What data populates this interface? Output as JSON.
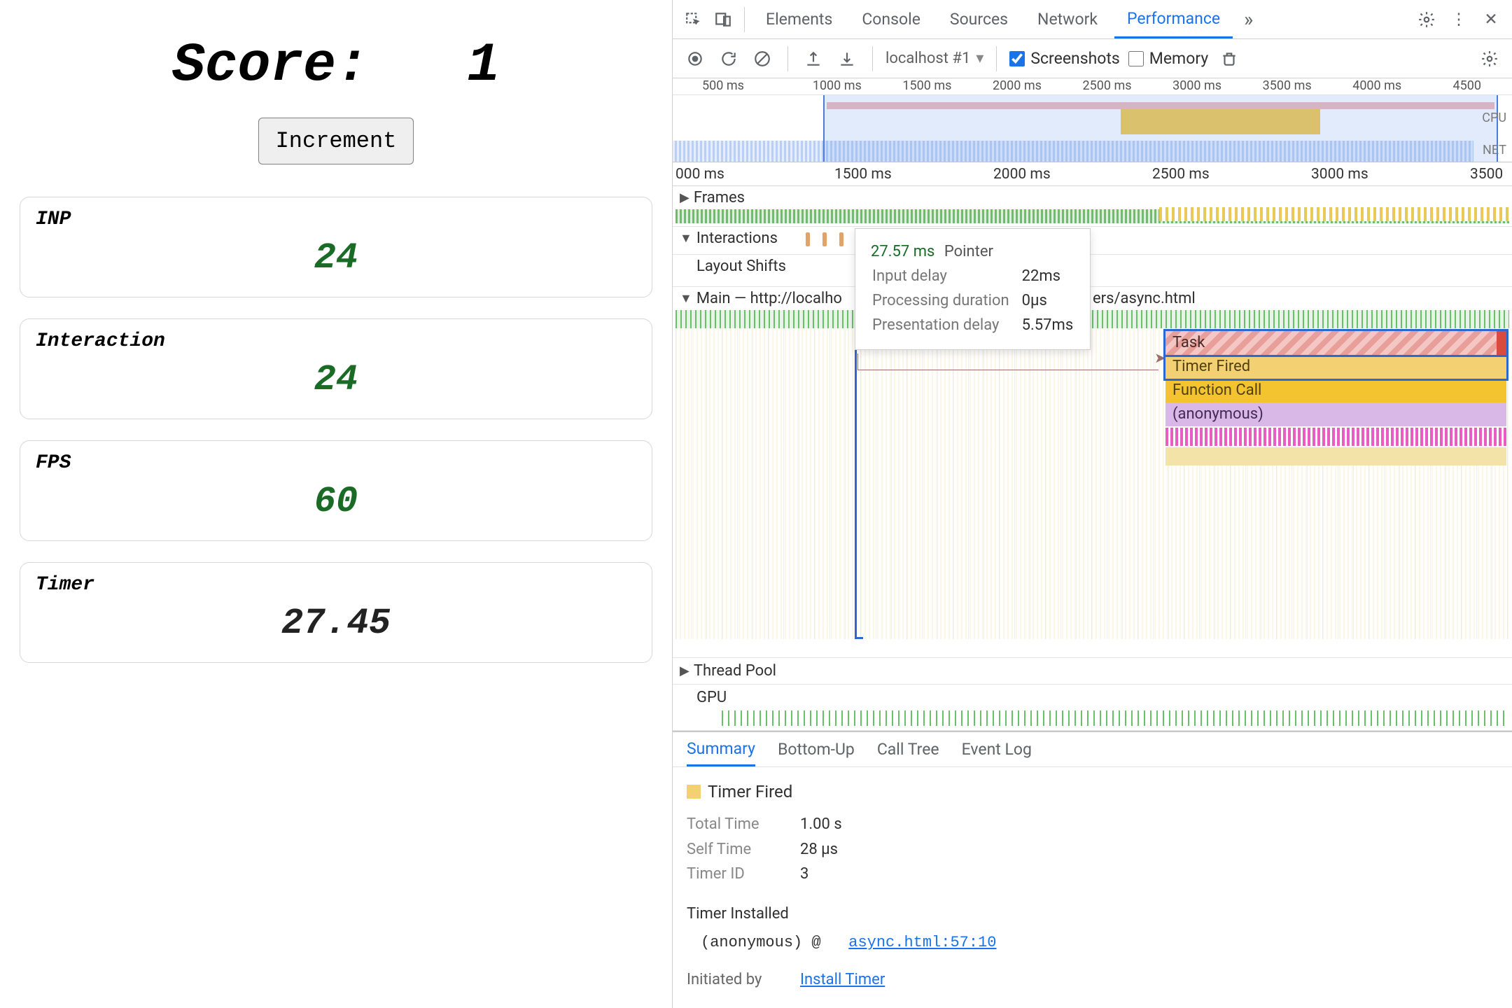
{
  "page": {
    "score_label": "Score:",
    "score_value": "1",
    "increment_label": "Increment",
    "metrics": {
      "inp": {
        "label": "INP",
        "value": "24"
      },
      "interaction": {
        "label": "Interaction",
        "value": "24"
      },
      "fps": {
        "label": "FPS",
        "value": "60"
      },
      "timer": {
        "label": "Timer",
        "value": "27.45"
      }
    }
  },
  "devtools": {
    "tabs": {
      "elements": "Elements",
      "console": "Console",
      "sources": "Sources",
      "network": "Network",
      "performance": "Performance"
    },
    "toolbar": {
      "recording_dd": "localhost #1",
      "screenshots_label": "Screenshots",
      "screenshots_checked": true,
      "memory_label": "Memory",
      "memory_checked": false
    },
    "mini_overview": {
      "ticks": [
        "500 ms",
        "1000 ms",
        "1500 ms",
        "2000 ms",
        "2500 ms",
        "3000 ms",
        "3500 ms",
        "4000 ms",
        "4500"
      ],
      "cpu_label": "CPU",
      "net_label": "NET"
    },
    "detail_ruler_ticks": [
      "000 ms",
      "1500 ms",
      "2000 ms",
      "2500 ms",
      "3000 ms",
      "3500"
    ],
    "tracks": {
      "frames": "Frames",
      "interactions": "Interactions",
      "layout_shifts": "Layout Shifts",
      "main_prefix": "Main — http://localho",
      "main_suffix": "ers/async.html",
      "thread_pool": "Thread Pool",
      "gpu": "GPU"
    },
    "tooltip": {
      "time": "27.57 ms",
      "kind": "Pointer",
      "rows": [
        {
          "k": "Input delay",
          "v": "22ms"
        },
        {
          "k": "Processing duration",
          "v": "0µs"
        },
        {
          "k": "Presentation delay",
          "v": "5.57ms"
        }
      ]
    },
    "flame": {
      "task": "Task",
      "timer": "Timer Fired",
      "func": "Function Call",
      "anon": "(anonymous)"
    },
    "detail_tabs": {
      "summary": "Summary",
      "bottom_up": "Bottom-Up",
      "call_tree": "Call Tree",
      "event_log": "Event Log"
    },
    "detail": {
      "title": "Timer Fired",
      "rows": [
        {
          "k": "Total Time",
          "v": "1.00 s"
        },
        {
          "k": "Self Time",
          "v": "28 µs"
        },
        {
          "k": "Timer ID",
          "v": "3"
        }
      ],
      "installed_label": "Timer Installed",
      "installed_frame": "(anonymous) @",
      "installed_link": "async.html:57:10",
      "initiated_label": "Initiated by",
      "initiated_link": "Install Timer"
    }
  }
}
